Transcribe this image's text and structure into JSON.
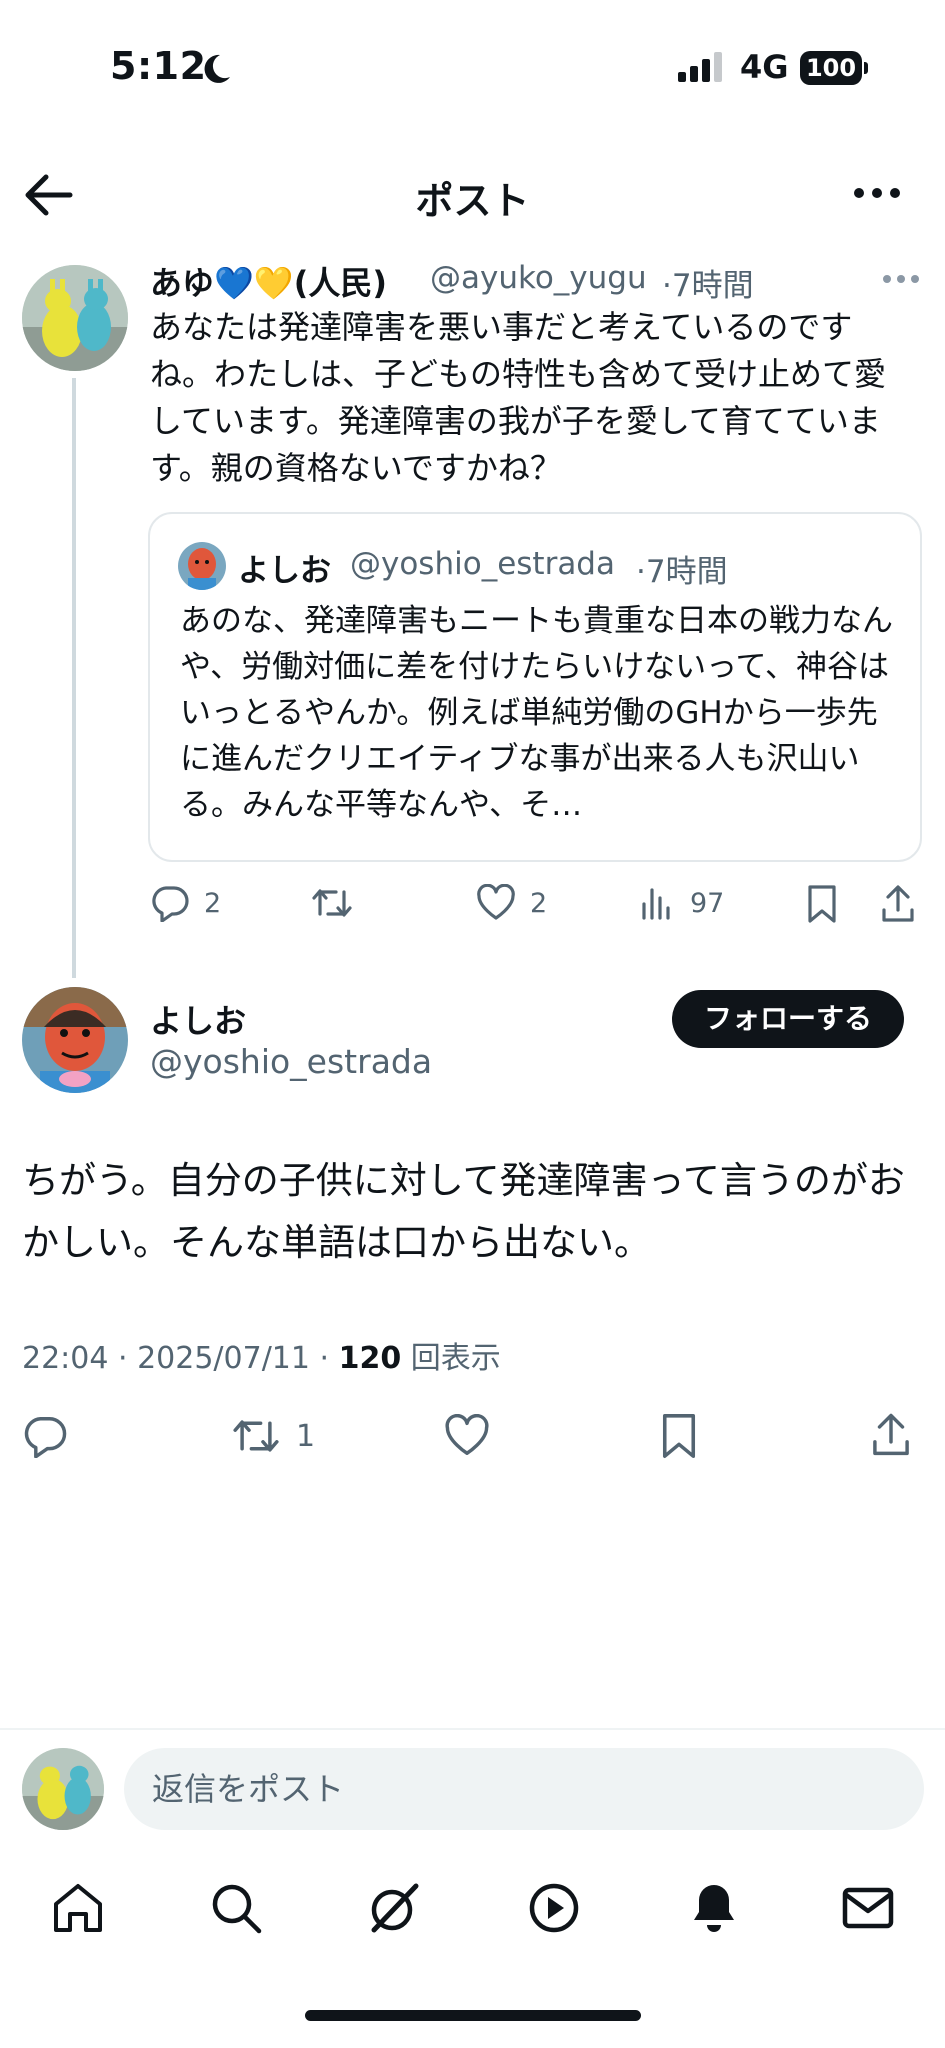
{
  "status_bar": {
    "time": "5:12",
    "network": "4G",
    "battery": "100"
  },
  "header": {
    "title": "ポスト"
  },
  "parent_tweet": {
    "name": "あゆ💙💛(人民)",
    "handle": "@ayuko_yugu",
    "time": "·7時間",
    "text": "あなたは発達障害を悪い事だと考えているのですね。わたしは、子どもの特性も含めて受け止めて愛しています。発達障害の我が子を愛して育てています。親の資格ないですかね？",
    "quote": {
      "name": "よしお",
      "handle": "@yoshio_estrada",
      "time": "·7時間",
      "text": "あのな、発達障害もニートも貴重な日本の戦力なんや、労働対価に差を付けたらいけないって、神谷はいっとるやんか。例えば単純労働のGHから一歩先に進んだクリエイティブな事が出来る人も沢山いる。みんな平等なんや、そ…"
    },
    "actions": {
      "replies": "2",
      "retweets": "",
      "likes": "2",
      "views": "97"
    }
  },
  "main_tweet": {
    "name": "よしお",
    "handle": "@yoshio_estrada",
    "follow_label": "フォローする",
    "text": "ちがう。自分の子供に対して発達障害って言うのがおかしい。そんな単語は口から出ない。",
    "timestamp": "22:04 · 2025/07/11 · ",
    "view_count": "120",
    "view_label": " 回表示",
    "actions": {
      "retweets": "1"
    }
  },
  "reply_bar": {
    "placeholder": "返信をポスト"
  },
  "icons": [
    "back-arrow-icon",
    "more-icon",
    "reply-icon",
    "retweet-icon",
    "like-icon",
    "views-icon",
    "bookmark-icon",
    "share-icon",
    "home-icon",
    "search-icon",
    "grok-icon",
    "play-icon",
    "bell-icon",
    "mail-icon"
  ],
  "colors": {
    "text": "#0f1419",
    "secondary": "#536471",
    "border": "#cfd9de"
  }
}
